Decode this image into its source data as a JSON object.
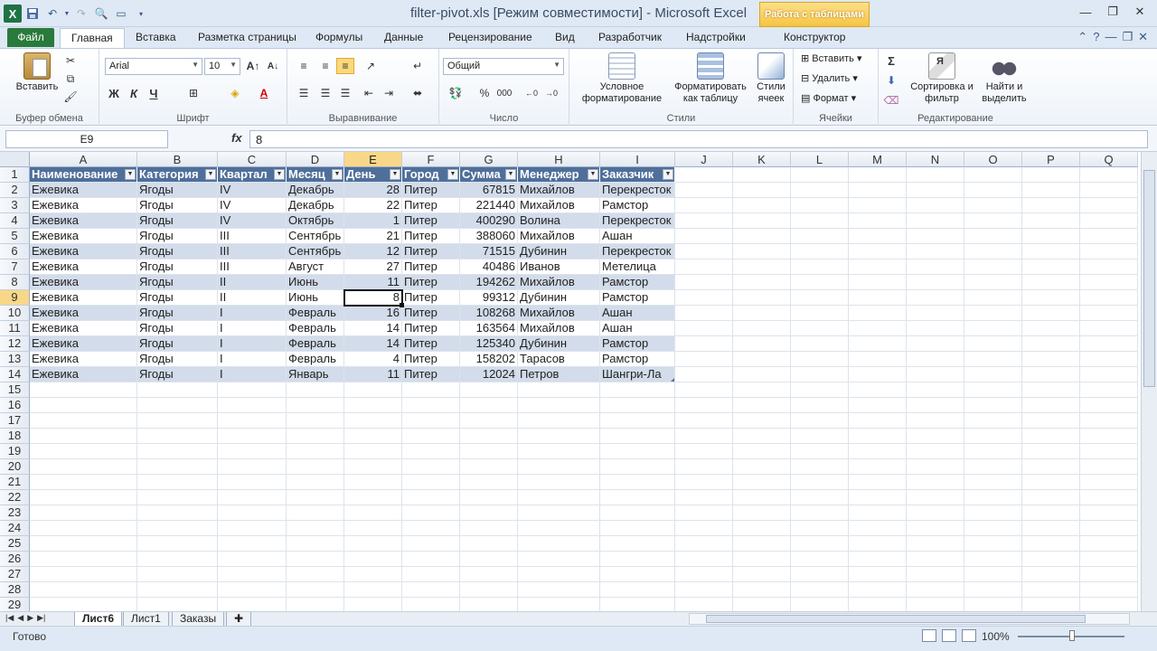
{
  "window": {
    "title": "filter-pivot.xls  [Режим совместимости]  -  Microsoft Excel",
    "context_tab": "Работа с таблицами"
  },
  "tabs": [
    "Файл",
    "Главная",
    "Вставка",
    "Разметка страницы",
    "Формулы",
    "Данные",
    "Рецензирование",
    "Вид",
    "Разработчик",
    "Надстройки",
    "Конструктор"
  ],
  "ribbon": {
    "clipboard": {
      "label": "Буфер обмена",
      "paste": "Вставить"
    },
    "font": {
      "label": "Шрифт",
      "name": "Arial",
      "size": "10",
      "bold": "Ж",
      "italic": "К",
      "underline": "Ч"
    },
    "alignment": {
      "label": "Выравнивание"
    },
    "number": {
      "label": "Число",
      "format": "Общий",
      "percent": "%",
      "thousands": "000"
    },
    "styles": {
      "label": "Стили",
      "cond_format": "Условное форматирование",
      "format_table": "Форматировать как таблицу",
      "cell_styles": "Стили ячеек"
    },
    "cells": {
      "label": "Ячейки",
      "insert": "Вставить",
      "delete": "Удалить",
      "format": "Формат"
    },
    "editing": {
      "label": "Редактирование",
      "sort": "Сортировка и фильтр",
      "find": "Найти и выделить",
      "sum": "Σ"
    }
  },
  "formula_bar": {
    "name_box": "E9",
    "fx": "fx",
    "value": "8"
  },
  "columns": [
    "A",
    "B",
    "C",
    "D",
    "E",
    "F",
    "G",
    "H",
    "I",
    "J",
    "K",
    "L",
    "M",
    "N",
    "O",
    "P",
    "Q"
  ],
  "rows": [
    "1",
    "2",
    "3",
    "4",
    "5",
    "6",
    "7",
    "8",
    "9",
    "10",
    "11",
    "12",
    "13",
    "14",
    "15",
    "16",
    "17",
    "18",
    "19",
    "20",
    "21",
    "22",
    "23",
    "24",
    "25",
    "26",
    "27",
    "28",
    "29"
  ],
  "table": {
    "headers": [
      "Наименование",
      "Категория",
      "Квартал",
      "Месяц",
      "День",
      "Город",
      "Сумма",
      "Менеджер",
      "Заказчик"
    ],
    "rows": [
      [
        "Ежевика",
        "Ягоды",
        "IV",
        "Декабрь",
        "28",
        "Питер",
        "67815",
        "Михайлов",
        "Перекресток"
      ],
      [
        "Ежевика",
        "Ягоды",
        "IV",
        "Декабрь",
        "22",
        "Питер",
        "221440",
        "Михайлов",
        "Рамстор"
      ],
      [
        "Ежевика",
        "Ягоды",
        "IV",
        "Октябрь",
        "1",
        "Питер",
        "400290",
        "Волина",
        "Перекресток"
      ],
      [
        "Ежевика",
        "Ягоды",
        "III",
        "Сентябрь",
        "21",
        "Питер",
        "388060",
        "Михайлов",
        "Ашан"
      ],
      [
        "Ежевика",
        "Ягоды",
        "III",
        "Сентябрь",
        "12",
        "Питер",
        "71515",
        "Дубинин",
        "Перекресток"
      ],
      [
        "Ежевика",
        "Ягоды",
        "III",
        "Август",
        "27",
        "Питер",
        "40486",
        "Иванов",
        "Метелица"
      ],
      [
        "Ежевика",
        "Ягоды",
        "II",
        "Июнь",
        "11",
        "Питер",
        "194262",
        "Михайлов",
        "Рамстор"
      ],
      [
        "Ежевика",
        "Ягоды",
        "II",
        "Июнь",
        "8",
        "Питер",
        "99312",
        "Дубинин",
        "Рамстор"
      ],
      [
        "Ежевика",
        "Ягоды",
        "I",
        "Февраль",
        "16",
        "Питер",
        "108268",
        "Михайлов",
        "Ашан"
      ],
      [
        "Ежевика",
        "Ягоды",
        "I",
        "Февраль",
        "14",
        "Питер",
        "163564",
        "Михайлов",
        "Ашан"
      ],
      [
        "Ежевика",
        "Ягоды",
        "I",
        "Февраль",
        "14",
        "Питер",
        "125340",
        "Дубинин",
        "Рамстор"
      ],
      [
        "Ежевика",
        "Ягоды",
        "I",
        "Февраль",
        "4",
        "Питер",
        "158202",
        "Тарасов",
        "Рамстор"
      ],
      [
        "Ежевика",
        "Ягоды",
        "I",
        "Январь",
        "11",
        "Питер",
        "12024",
        "Петров",
        "Шангри-Ла"
      ]
    ]
  },
  "sheets": [
    "Лист6",
    "Лист1",
    "Заказы"
  ],
  "status": {
    "ready": "Готово",
    "zoom": "100%"
  }
}
